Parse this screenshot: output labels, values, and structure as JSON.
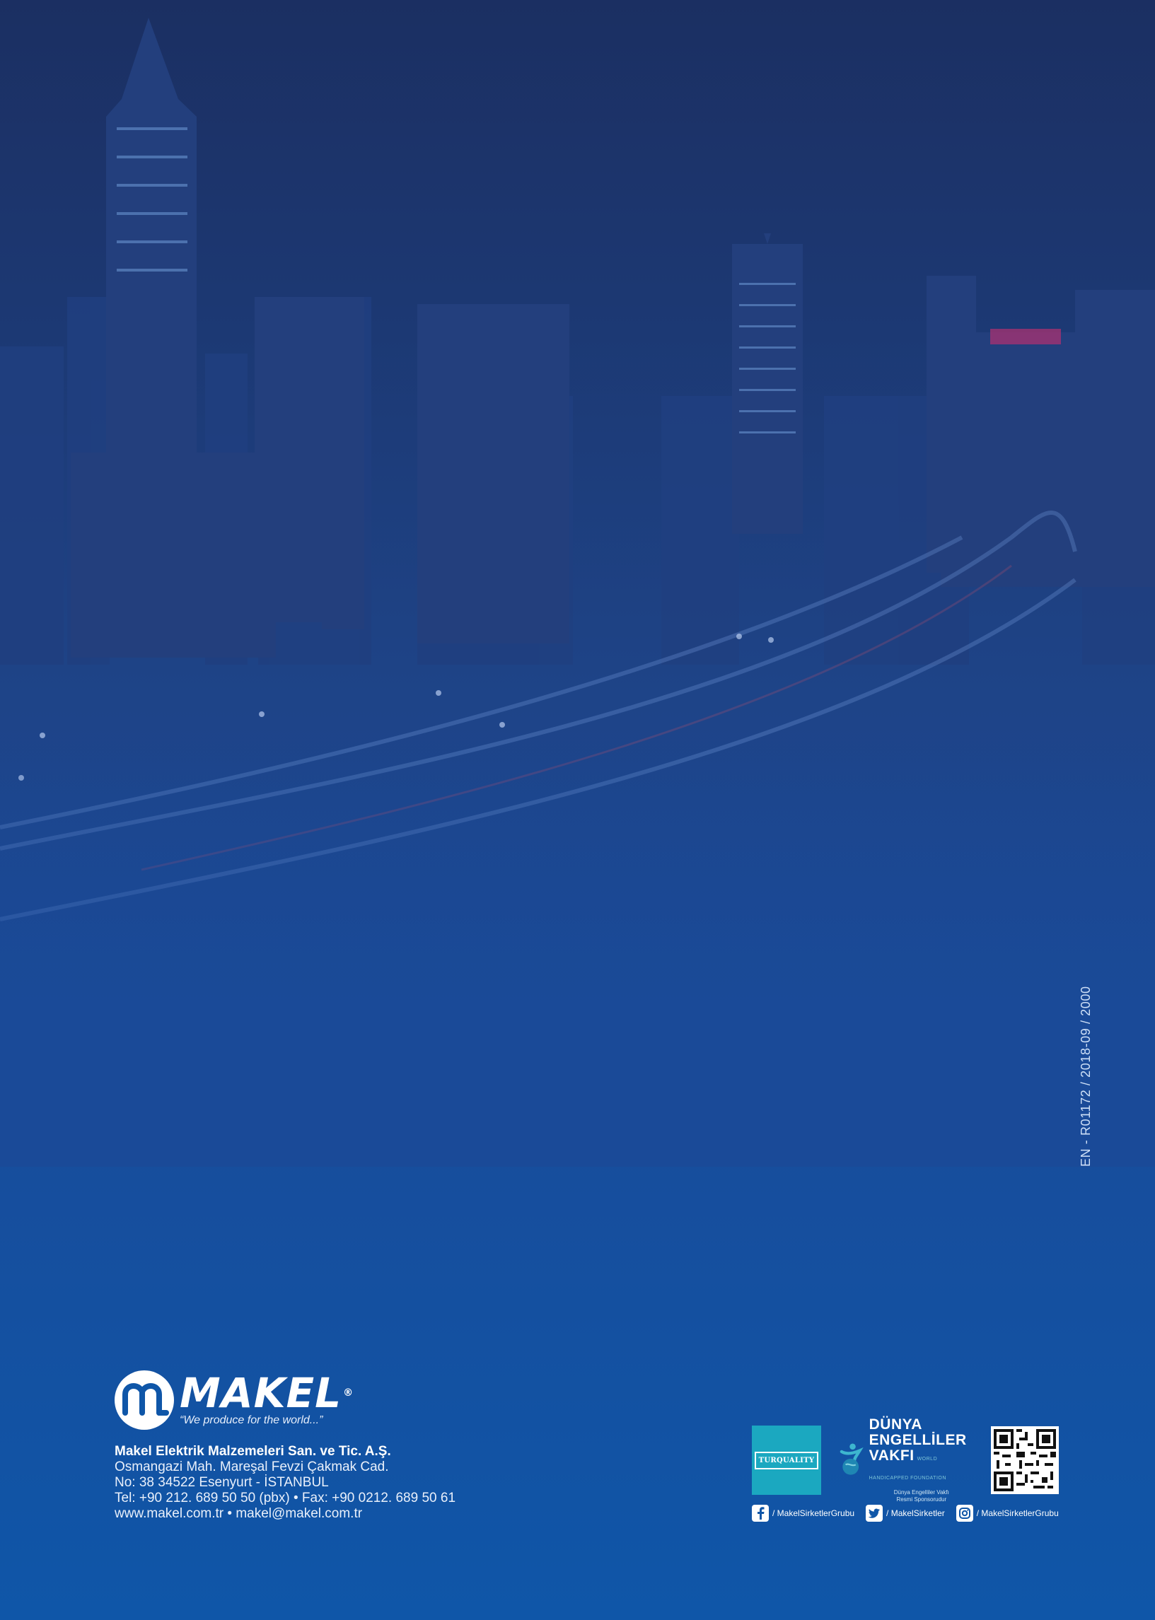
{
  "document_code": "EN - R01172 / 2018-09 / 2000",
  "company": {
    "logo_wordmark": "MAKEL",
    "logo_registered": "®",
    "slogan": "“We produce for the world...”",
    "name": "Makel Elektrik Malzemeleri San. ve Tic. A.Ş.",
    "address_line1": "Osmangazi Mah. Mareşal Fevzi Çakmak Cad.",
    "address_line2": "No: 38 34522 Esenyurt - İSTANBUL",
    "phone_fax": "Tel: +90 212. 689 50 50 (pbx)  •  Fax: +90 0212. 689 50 61",
    "web_email": "www.makel.com.tr  •  makel@makel.com.tr"
  },
  "badges": {
    "turquality": "TURQUALITY",
    "foundation_line1": "DÜNYA",
    "foundation_line2": "ENGELLİLER",
    "foundation_line3": "VAKFI",
    "foundation_en": "WORLD HANDICAPPED FOUNDATION",
    "foundation_sub1": "Dünya Engelliler Vakfı",
    "foundation_sub2": "Resmi Sponsorudur"
  },
  "socials": [
    {
      "icon": "facebook-icon",
      "handle": "/ MakelSirketlerGrubu"
    },
    {
      "icon": "twitter-icon",
      "handle": "/ MakelSirketler"
    },
    {
      "icon": "instagram-icon",
      "handle": "/ MakelSirketlerGrubu"
    }
  ],
  "colors": {
    "background_top": "#1b2f62",
    "background_bottom": "#0f56a8",
    "turquality_box": "#1ba8c0"
  }
}
